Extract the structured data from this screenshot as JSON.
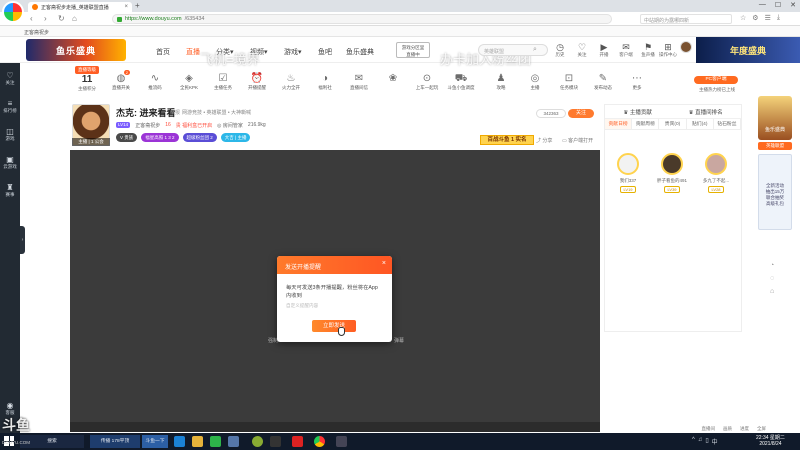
{
  "browser": {
    "tab_title": "正客斋祝步走播_英雄联盟直播",
    "tab_close": "×",
    "new_tab": "+",
    "win_controls": [
      "—",
      "☐",
      "✕"
    ],
    "nav_icons": [
      "‹",
      "›",
      "↻",
      "⌂"
    ],
    "url_host": "https://www.douyu.com",
    "url_path": "/635434",
    "search_placeholder": "中站期的为露哪四新",
    "toolbar_icons": [
      "☆",
      "⚙",
      "☰",
      "⤓"
    ],
    "bookmark": "正客斋祝步"
  },
  "header": {
    "logo_text": "鱼乐盛典",
    "nav": [
      {
        "label": "首页",
        "active": false
      },
      {
        "label": "直播",
        "active": true
      },
      {
        "label": "分类▾",
        "active": false
      },
      {
        "label": "视频▾",
        "active": false
      },
      {
        "label": "游戏▾",
        "active": false
      },
      {
        "label": "鱼吧",
        "active": false
      },
      {
        "label": "鱼乐盛典",
        "active": false
      }
    ],
    "watermark_left": "飞机=境界",
    "watermark_right": "办卡加入粉丝团",
    "game_badge": [
      "游戏分区里",
      "直播中"
    ],
    "search_placeholder": "英雄联盟",
    "search_icon": "⌕",
    "icons": [
      {
        "glyph": "◷",
        "label": "历史"
      },
      {
        "glyph": "♡",
        "label": "关注"
      },
      {
        "glyph": "▶",
        "label": "开播"
      },
      {
        "glyph": "✉",
        "label": "客户端"
      },
      {
        "glyph": "⚑",
        "label": "鱼声播"
      },
      {
        "glyph": "⊞",
        "label": "操作中心"
      }
    ],
    "banner": "年度盛典"
  },
  "sidebar": {
    "items": [
      {
        "glyph": "♡",
        "label": "关注"
      },
      {
        "glyph": "≡",
        "label": "排行榜"
      },
      {
        "glyph": "◫",
        "label": "游戏"
      },
      {
        "glyph": "▣",
        "label": "云游戏"
      },
      {
        "glyph": "♜",
        "label": "赛事"
      },
      {
        "glyph": "◉",
        "label": "客服"
      }
    ],
    "expand": "›"
  },
  "toolbar": {
    "level_tag": "直播等级",
    "level_num": "11",
    "level_label": "主播积分",
    "tools": [
      {
        "glyph": "◍",
        "label": "直播开关",
        "badge": "2"
      },
      {
        "glyph": "∿",
        "label": "推流码",
        "badge": ""
      },
      {
        "glyph": "◈",
        "label": "全民KPK",
        "badge": ""
      },
      {
        "glyph": "☑",
        "label": "主播任务",
        "badge": ""
      },
      {
        "glyph": "⏰",
        "label": "开播提醒",
        "badge": ""
      },
      {
        "glyph": "♨",
        "label": "火力全开",
        "badge": ""
      },
      {
        "glyph": "◑",
        "label": "福利社",
        "badge": ""
      },
      {
        "glyph": "✉",
        "label": "直播间信",
        "badge": ""
      },
      {
        "glyph": "❀",
        "label": "",
        "badge": ""
      },
      {
        "glyph": "⊙",
        "label": "上车一起玩",
        "badge": ""
      },
      {
        "glyph": "⛟",
        "label": "斗鱼小鱼调度",
        "badge": ""
      },
      {
        "glyph": "♟",
        "label": "攻略",
        "badge": ""
      },
      {
        "glyph": "◎",
        "label": "主播",
        "badge": ""
      },
      {
        "glyph": "⊡",
        "label": "任务模块",
        "badge": ""
      },
      {
        "glyph": "✎",
        "label": "发布动态",
        "badge": ""
      },
      {
        "glyph": "⋯",
        "label": "更多",
        "badge": ""
      }
    ],
    "pc_client": "PC客户端",
    "pc_sub": "主播热力榜已上线"
  },
  "room": {
    "title": "杰克: 进来看看",
    "report": "举报",
    "category": "网游竞技 • 英雄联盟 • 大神嘶喊",
    "meta_tag": "LV14",
    "meta_name": "正客斋祝步",
    "meta_hot": "16",
    "meta_badge": "贵 福利盒已开启",
    "meta_room": "◎ 房间管家",
    "meta_fans": "216.9kg",
    "badges": [
      {
        "text": "V 贵族",
        "color": "#4a4a4a"
      },
      {
        "text": "福星高照 1 3 2",
        "color": "#9b34d6"
      },
      {
        "text": "超级粉丝团 2",
        "color": "#5a4dd6"
      },
      {
        "text": "大吉 | 主播",
        "color": "#2cb7e8"
      }
    ],
    "photo_tag": "主播 | 1 公会",
    "heat": "342363",
    "follow": "关注",
    "rank_strip": "百战斗鱼 1 实名",
    "share": "⤴ 分享",
    "client_watch": "▭ 客户端打开"
  },
  "player": {
    "overlay_left": "强制",
    "overlay_right": "弹幕"
  },
  "modal": {
    "title": "发送开播提醒",
    "close": "×",
    "body": "每天可发送3条开播提醒，粉丝将在App内收到",
    "hint": "自定义提醒内容",
    "send": "立即发送"
  },
  "right": {
    "top_left": "♛ 主播贡献",
    "top_right": "♛ 直播间排名",
    "tabs": [
      {
        "label": "贡献日榜",
        "on": true
      },
      {
        "label": "贡献周榜",
        "on": false
      },
      {
        "label": "贵宾(0)",
        "on": false
      },
      {
        "label": "贴们(4)",
        "on": false
      },
      {
        "label": "钻石粉丝",
        "on": false
      }
    ],
    "ranks": [
      {
        "name": "我们337",
        "level": "LV19",
        "color": "#f2f2f2"
      },
      {
        "name": "胖子看鱼的491",
        "level": "LV39",
        "color": "#4a3a2a"
      },
      {
        "name": "多九了不起...",
        "level": "LV28",
        "color": "#c9a7a0"
      }
    ],
    "banner_title": "鱼乐盛典",
    "banner_tag": "英雄联盟",
    "banner_card": [
      "全新活动",
      "抽出15万",
      "联合抽奖",
      "高级礼包"
    ],
    "side_icons": [
      "◔",
      "◌",
      "⌂"
    ]
  },
  "bottom": [
    "直播间",
    "画质",
    "进度",
    "全屏"
  ],
  "taskbar": {
    "apps": [
      {
        "label": "搜索",
        "color": "#1a2740",
        "w": 64
      },
      {
        "label": "传播 178平顶",
        "color": "#1e3d6d",
        "w": 50
      },
      {
        "label": "斗鱼一下",
        "color": "#2c5fa5",
        "w": 26
      }
    ],
    "tray": [
      "^",
      "♫",
      "▯",
      "中"
    ],
    "time": "22:34 星期二",
    "date": "2021/8/24"
  },
  "logo_mark": "斗鱼",
  "logo_url": "DOUYU.COM"
}
